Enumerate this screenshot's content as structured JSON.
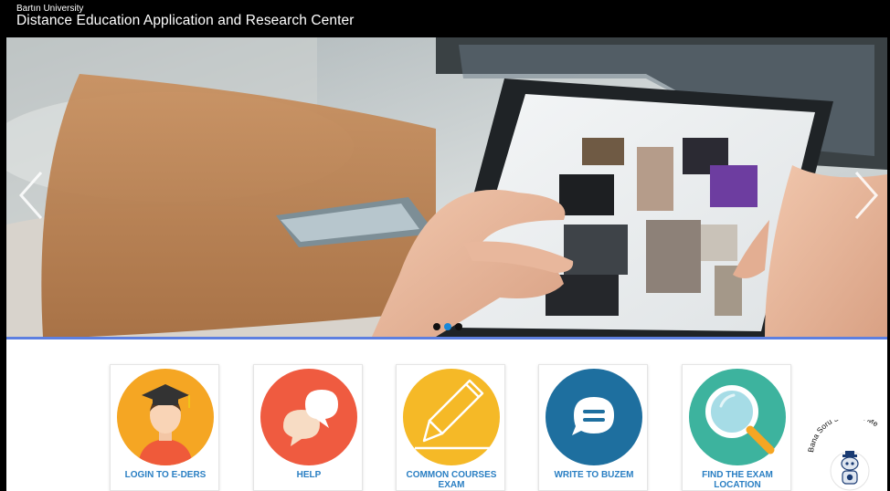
{
  "header": {
    "university": "Bartın University",
    "center_name": "Distance Education Application and Research Center"
  },
  "slider": {
    "slide_count": 3,
    "active_slide_index": 1
  },
  "quick_links": [
    {
      "label": "LOGIN TO E-DERS",
      "icon": "graduate-avatar-icon",
      "color": "#f5a623"
    },
    {
      "label": "HELP",
      "icon": "speech-bubbles-icon",
      "color": "#ef5b40"
    },
    {
      "label": "COMMON COURSES EXAM",
      "icon": "pencil-icon",
      "color": "#f5b927"
    },
    {
      "label": "WRITE TO BUZEM",
      "icon": "chat-bubble-icon",
      "color": "#1e6f9f"
    },
    {
      "label": "FIND THE EXAM LOCATION",
      "icon": "magnifier-icon",
      "color": "#3db39e"
    }
  ],
  "assistant": {
    "caption": "Bana Soru Sor | Ask Me",
    "icon": "robot-icon"
  },
  "colors": {
    "accent_line": "#5d7fe0",
    "link_text": "#2a7fc3",
    "header_bg": "#000000"
  }
}
